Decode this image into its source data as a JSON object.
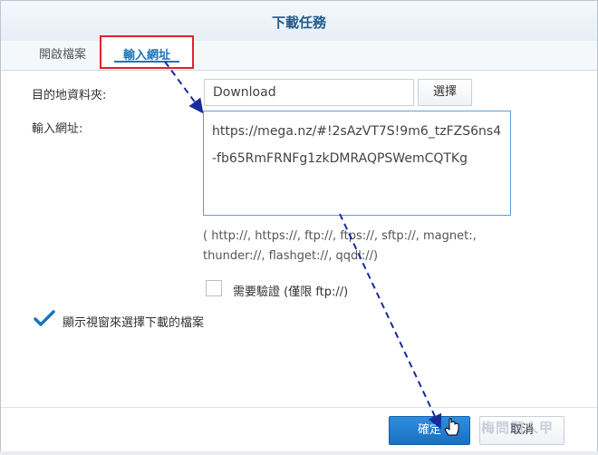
{
  "dialog": {
    "title": "下載任務"
  },
  "tabs": [
    {
      "label": "開啟檔案",
      "active": false
    },
    {
      "label": "輸入網址",
      "active": true
    }
  ],
  "form": {
    "destination_label": "目的地資料夾:",
    "destination_value": "Download",
    "choose_button": "選擇",
    "url_label": "輸入網址:",
    "url_lines": [
      "https://mega.nz/#!2sAzVT7S!9m6_tzFZS6ns4",
      "-fb65RmFRNFg1zkDMRAQPSWemCQTKg"
    ],
    "protocol_hint_line1": "( http://, https://, ftp://, ftps://, sftp://, magnet:,",
    "protocol_hint_line2": "thunder://, flashget://, qqdl://)",
    "auth_checkbox_label": "需要驗證 (僅限 ftp://)",
    "auth_checked": false,
    "show_window_label": "顯示視窗來選擇下載的檔案",
    "show_window_checked": true
  },
  "footer": {
    "ok_button": "確定",
    "cancel_button": "取消"
  },
  "watermark": "梅問題人甲",
  "colors": {
    "accent": "#1d75bd",
    "highlight_border": "#e0232b",
    "arrow": "#1a2a9c",
    "ok_button": "#2a86d8"
  }
}
